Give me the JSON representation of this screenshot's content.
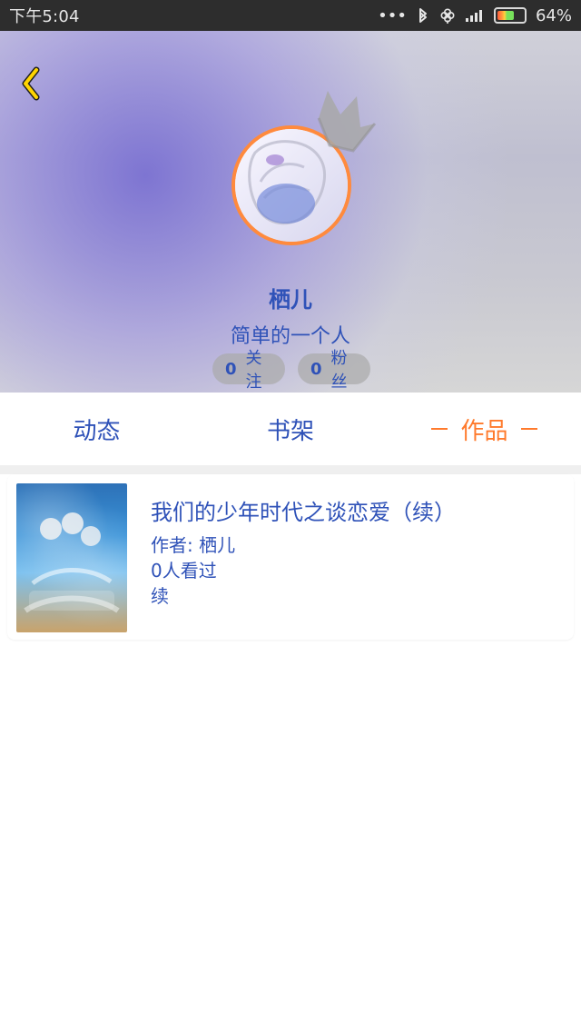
{
  "status_bar": {
    "time": "下午5:04",
    "battery_percent": "64%",
    "battery_level": 0.64,
    "icons": [
      "more-dots-icon",
      "bluetooth-icon",
      "clover-icon",
      "signal-icon",
      "battery-icon"
    ]
  },
  "profile": {
    "back_icon": "chevron-left-icon",
    "avatar_icon": "avatar-image",
    "crown_icon": "crown-icon",
    "name": "栖儿",
    "bio": "简单的一个人",
    "follow": {
      "count": "0",
      "label": "关注"
    },
    "fans": {
      "count": "0",
      "label": "粉丝"
    }
  },
  "tabs": [
    {
      "label": "动态"
    },
    {
      "label": "书架"
    },
    {
      "label": "作品"
    }
  ],
  "colors": {
    "accent_blue": "#2f52b8",
    "accent_orange": "#ff7a2c"
  },
  "works": [
    {
      "title": "我们的少年时代之谈恋爱（续）",
      "author_label": "作者:",
      "author": "栖儿",
      "views_text": "0人看过",
      "status": "续"
    }
  ]
}
